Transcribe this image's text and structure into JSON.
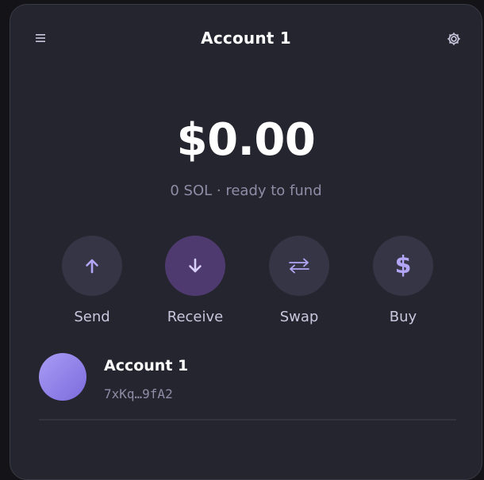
{
  "header": {
    "title": "Account 1",
    "menu_icon": "hamburger-menu-icon",
    "settings_icon": "gear-icon"
  },
  "balance": {
    "amount": "$0.00",
    "subtitle": "0 SOL · ready to fund"
  },
  "actions": [
    {
      "label": "Send",
      "icon": "arrow-up-icon"
    },
    {
      "label": "Receive",
      "icon": "arrow-down-icon"
    },
    {
      "label": "Swap",
      "icon": "swap-arrows-icon"
    },
    {
      "label": "Buy",
      "icon": "dollar-icon",
      "glyph": "$"
    }
  ],
  "account": {
    "name": "Account 1",
    "address": "7xKq…9fA2"
  },
  "colors": {
    "panel_background": "#25252f",
    "accent": "#b3a5f5",
    "primary_action": "#4e3a6f"
  }
}
